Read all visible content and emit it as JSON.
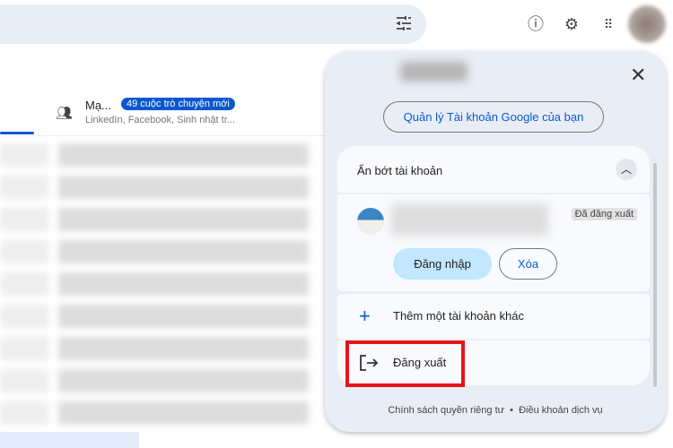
{
  "header": {
    "icons": [
      "tune-icon",
      "help-icon",
      "settings-icon",
      "apps-icon",
      "avatar"
    ]
  },
  "tab": {
    "title": "Mạ...",
    "badge": "49 cuộc trò chuyện mới",
    "subtitle": "LinkedIn, Facebook, Sinh nhật tr..."
  },
  "panel": {
    "close": "✕",
    "manage_button": "Quản lý Tài khoản Google của bạn",
    "hide_accounts": "Ẩn bớt tài khoản",
    "account_status": "Đã đăng xuất",
    "login_button": "Đăng nhập",
    "remove_button": "Xóa",
    "add_account": "Thêm một tài khoản khác",
    "sign_out": "Đăng xuất",
    "privacy": "Chính sách quyền riêng tư",
    "separator": "•",
    "terms": "Điều khoản dịch vụ"
  }
}
